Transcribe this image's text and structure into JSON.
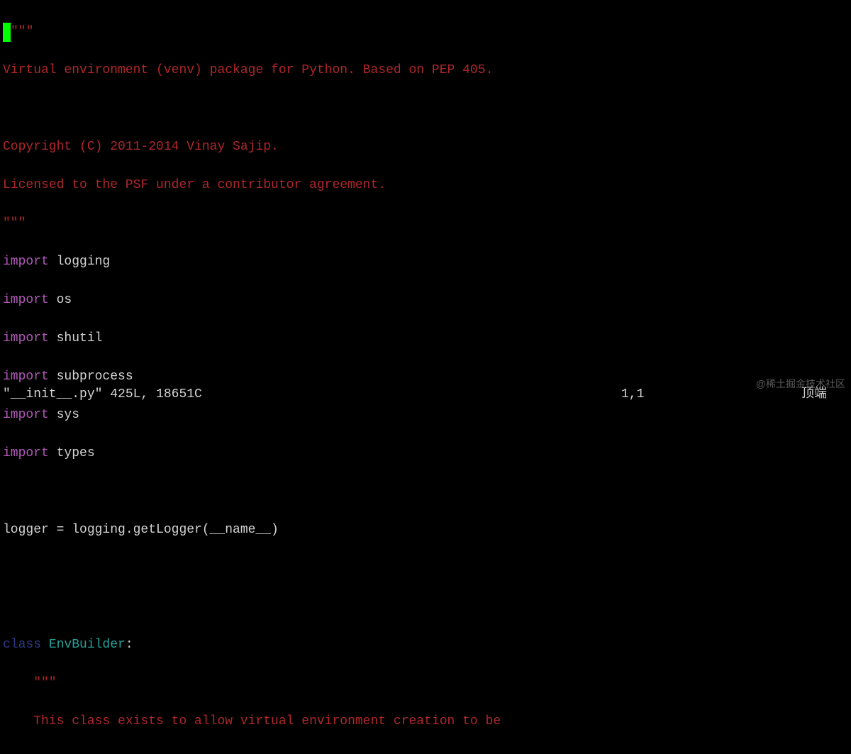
{
  "code": {
    "line1_cursor": " ",
    "line1_rest": "\"\"\"",
    "line2": "Virtual environment (venv) package for Python. Based on PEP 405.",
    "line3": "",
    "line4": "Copyright (C) 2011-2014 Vinay Sajip.",
    "line5": "Licensed to the PSF under a contributor agreement.",
    "line6": "\"\"\"",
    "kw_import": "import",
    "mod_logging": " logging",
    "mod_os": " os",
    "mod_shutil": " shutil",
    "mod_subprocess": " subprocess",
    "mod_sys": " sys",
    "mod_types": " types",
    "logger_line": "logger = logging.getLogger(__name__)",
    "kw_class": "class",
    "classname": " EnvBuilder",
    "colon": ":",
    "docstring_open": "    \"\"\"",
    "docstring_line": "    This class exists to allow virtual environment creation to be"
  },
  "status": {
    "filename": "\"__init__.py\" 425L, 18651C",
    "position": "1,1",
    "location": "顶端"
  },
  "watermark": "@稀土掘金技术社区"
}
